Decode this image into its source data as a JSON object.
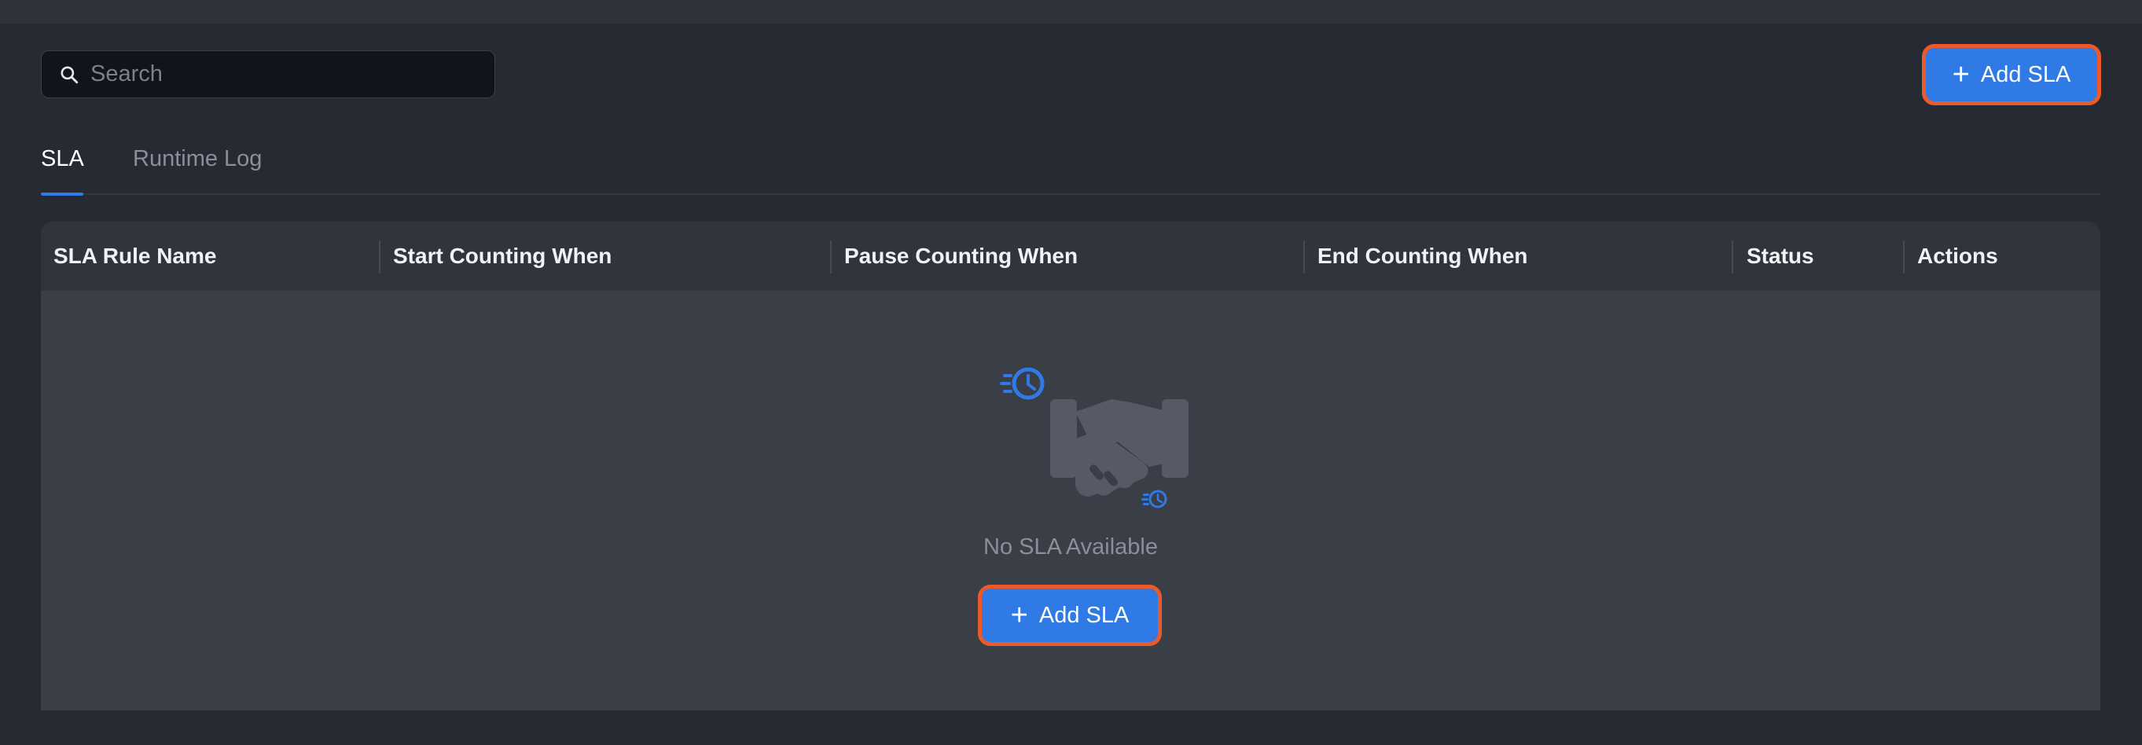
{
  "search": {
    "placeholder": "Search",
    "icon": "search-icon"
  },
  "header": {
    "add_button_label": "Add SLA"
  },
  "tabs": [
    {
      "label": "SLA",
      "active": true
    },
    {
      "label": "Runtime Log",
      "active": false
    }
  ],
  "table": {
    "columns": [
      "SLA Rule Name",
      "Start Counting When",
      "Pause Counting When",
      "End Counting When",
      "Status",
      "Actions"
    ],
    "rows": [],
    "empty_state": {
      "message": "No SLA Available",
      "button_label": "Add SLA",
      "illustration": "handshake-clock-icon"
    }
  },
  "colors": {
    "background": "#262a33",
    "accent": "#2f7ae5",
    "highlight_border": "#ec5a2b",
    "table_body": "#3a3e47",
    "table_header": "#30343d"
  }
}
